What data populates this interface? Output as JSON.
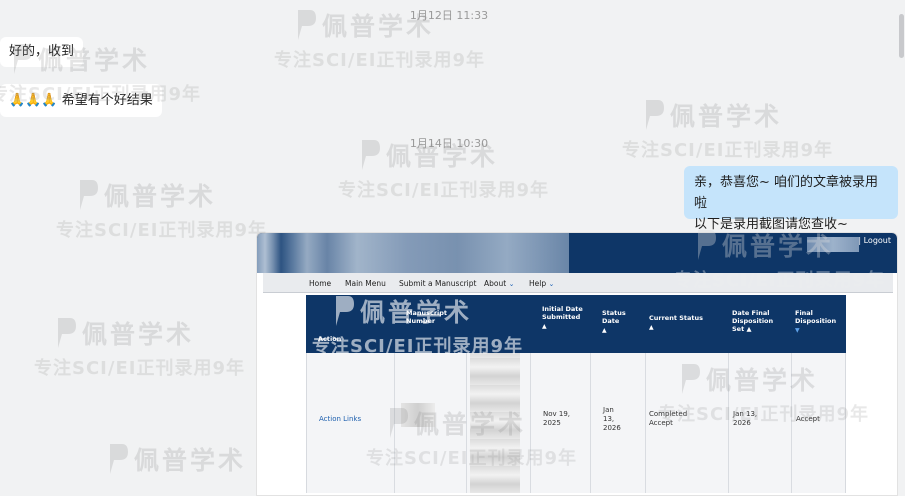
{
  "timestamps": {
    "first": "1月12日 11:33",
    "second": "1月14日 10:30"
  },
  "incoming": {
    "msg1": "好的，收到",
    "msg2_emoji": "🙏🙏🙏",
    "msg2_text": "希望有个好结果"
  },
  "outgoing": {
    "line1": "亲，恭喜您~ 咱们的文章被录用啦",
    "line2": "以下是录用截图请您查收~"
  },
  "watermark": {
    "brand": "佩普学术",
    "slogan": "专注SCI/EI正刊录用9年"
  },
  "journal": {
    "logout_sep": "|",
    "logout": "Logout",
    "nav": {
      "home": "Home",
      "main_menu": "Main Menu",
      "submit": "Submit a Manuscript",
      "about": "About",
      "help": "Help",
      "chevron": "⌄"
    },
    "table": {
      "headers": {
        "action": "Action",
        "manuscript_number": "Manuscript Number",
        "initial_date_submitted": "Initial Date Submitted",
        "status_date": "Status Date",
        "current_status": "Current Status",
        "date_final_disposition_set": "Date Final Disposition Set",
        "final_disposition": "Final Disposition",
        "sort_up": "▲",
        "sort_down": "▼"
      },
      "row": {
        "action_links": "Action Links",
        "initial_date_submitted": "Nov 19, 2025",
        "status_date": "Jan 13, 2026",
        "current_status": "Completed Accept",
        "date_final_disposition_set": "Jan 13, 2026",
        "final_disposition": "Accept"
      }
    }
  },
  "colors": {
    "journal_navy": "#0e3667",
    "bubble_out": "#c5e4fb",
    "link_blue": "#1d5fae"
  }
}
